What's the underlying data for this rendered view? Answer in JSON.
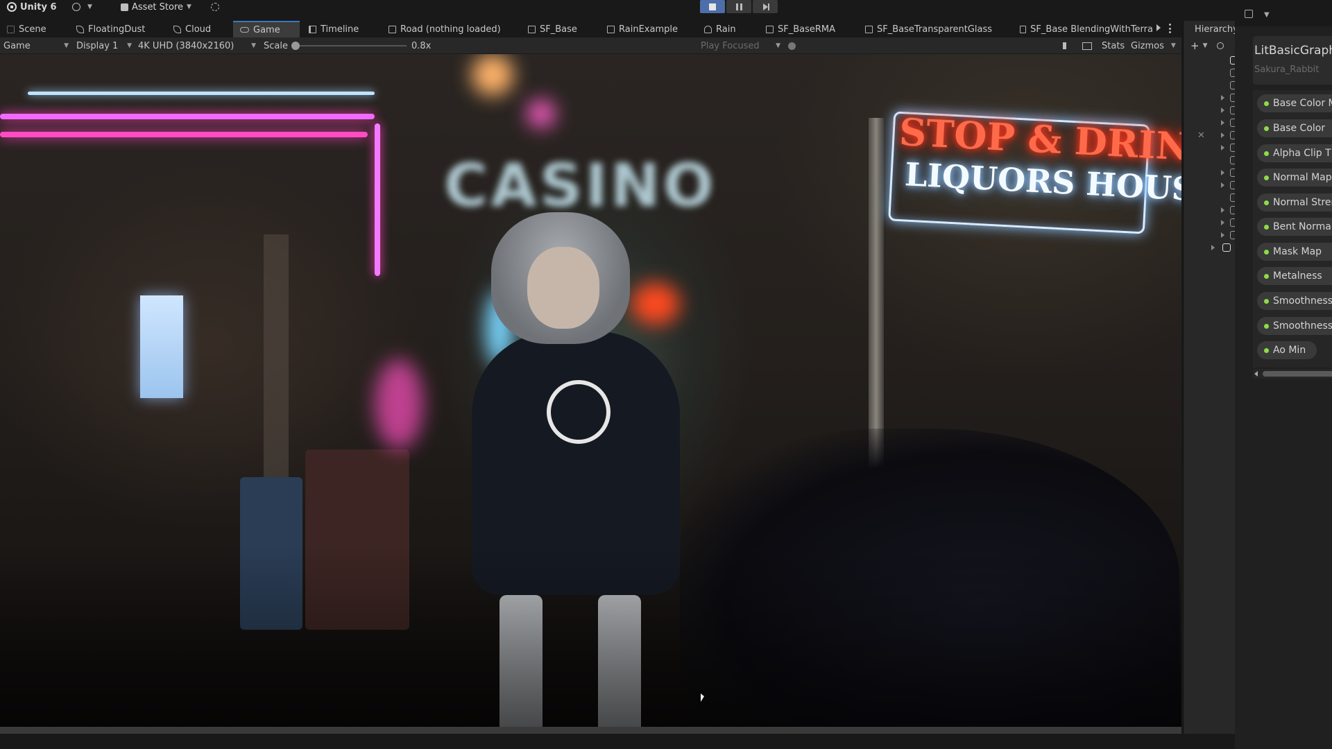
{
  "titlebar": {
    "app_name": "Unity 6",
    "account_label": "",
    "asset_store_label": "Asset Store",
    "play_state": "playing"
  },
  "tabs": [
    {
      "label": "Scene",
      "icon": "grid-icon"
    },
    {
      "label": "FloatingDust",
      "icon": "leaf-icon"
    },
    {
      "label": "Cloud",
      "icon": "leaf-icon"
    },
    {
      "label": "Game",
      "icon": "gamepad-icon",
      "active": true
    },
    {
      "label": "Timeline",
      "icon": "timeline-icon"
    },
    {
      "label": "Road (nothing loaded)",
      "icon": "document-icon"
    },
    {
      "label": "SF_Base",
      "icon": "document-icon"
    },
    {
      "label": "RainExample",
      "icon": "document-icon"
    },
    {
      "label": "Rain",
      "icon": "person-icon"
    },
    {
      "label": "SF_BaseRMA",
      "icon": "document-icon"
    },
    {
      "label": "SF_BaseTransparentGlass",
      "icon": "document-icon"
    },
    {
      "label": "SF_Base BlendingWithTerra",
      "icon": "document-icon"
    }
  ],
  "game_toolbar": {
    "view_mode": "Game",
    "display": "Display 1",
    "resolution": "4K UHD (3840x2160)",
    "scale_label": "Scale",
    "scale_value": "0.8x",
    "play_mode": "Play Focused",
    "stats_label": "Stats",
    "gizmos_label": "Gizmos"
  },
  "scene": {
    "sign_line1": "STOP & DRINK",
    "sign_line2": "LIQUORS HOUSE",
    "blurred_sign": "CASINO",
    "sign_color": "#ff5a3c",
    "neon_pink": "#ff3fb8",
    "neon_blue": "#9fd3ff"
  },
  "hierarchy": {
    "tab_label": "Hierarchy",
    "add_label": "+"
  },
  "shader_graph": {
    "blackboard_title": "LitBasicGraph",
    "blackboard_subtitle": "Sakura_Rabbit",
    "properties": [
      "Base Color Map",
      "Base Color",
      "Alpha Clip Threshold",
      "Normal Map",
      "Normal Strength",
      "Bent Normal Map",
      "Mask Map",
      "Metalness",
      "Smoothness Map",
      "Smoothness",
      "Ao Min"
    ],
    "property_dot_color": "#8edb4a"
  }
}
